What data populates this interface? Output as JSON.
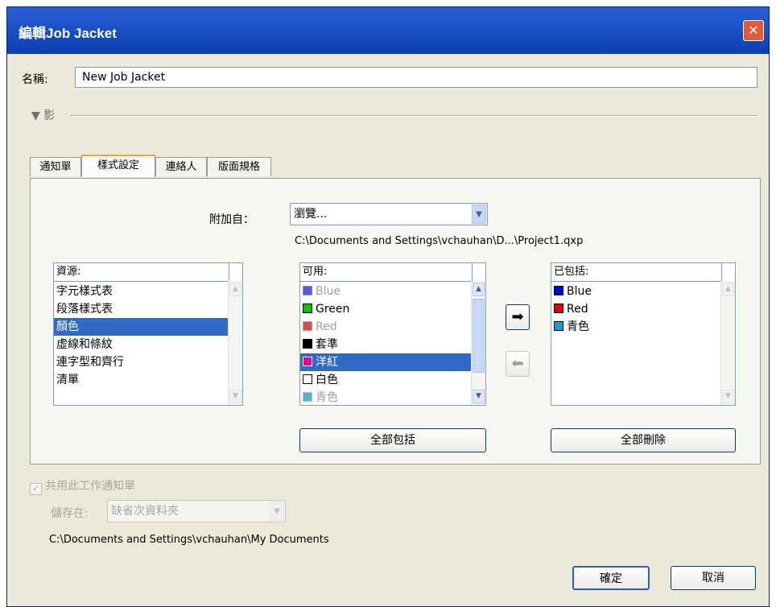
{
  "window": {
    "title": "編輯Job Jacket",
    "close_label": "✕"
  },
  "name_label": "名稱:",
  "name_value": "New Job Jacket",
  "collapse_label": "▼ 影",
  "tabs": [
    "通知單",
    "樣式設定",
    "連絡人",
    "版面規格"
  ],
  "append_from": {
    "label": "附加自：",
    "value": "瀏覽...",
    "path": "C:\\Documents and Settings\\vchauhan\\D...\\Project1.qxp"
  },
  "resources": {
    "header": "資源:",
    "items": [
      "字元樣式表",
      "段落樣式表",
      "顏色",
      "虛線和條紋",
      "連字型和齊行",
      "清單"
    ],
    "selected_index": 2
  },
  "available": {
    "header": "可用:",
    "items": [
      {
        "label": "Blue",
        "color": "#5a5ad6",
        "disabled": true
      },
      {
        "label": "Green",
        "color": "#00c800",
        "disabled": false
      },
      {
        "label": "Red",
        "color": "#d05050",
        "disabled": true
      },
      {
        "label": "套準",
        "color": "#000000",
        "disabled": false
      },
      {
        "label": "洋紅",
        "color": "#e0009c",
        "disabled": false
      },
      {
        "label": "白色",
        "color": "#ffffff",
        "disabled": false
      },
      {
        "label": "青色",
        "color": "#5aaed0",
        "disabled": true
      }
    ],
    "selected_index": 4
  },
  "included": {
    "header": "已包括:",
    "items": [
      {
        "label": "Blue",
        "color": "#0000d0"
      },
      {
        "label": "Red",
        "color": "#e00000"
      },
      {
        "label": "青色",
        "color": "#1a9be0"
      }
    ]
  },
  "arrows": {
    "add": "➡",
    "remove": "⬅"
  },
  "include_all_button": "全部包括",
  "remove_all_button": "全部刪除",
  "share_checkbox": {
    "label": "共用此工作通知單",
    "checked": true
  },
  "save_in": {
    "label": "儲存在:",
    "value": "缺省次資料夾"
  },
  "save_path": "C:\\Documents and Settings\\vchauhan\\My Documents",
  "ok_button": "確定",
  "cancel_button": "取消"
}
